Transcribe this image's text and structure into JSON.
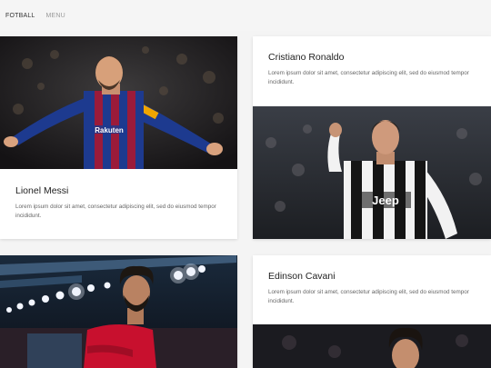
{
  "nav": {
    "brand": "FOTBALL",
    "menu": "MENU"
  },
  "cards": [
    {
      "title": "Lionel Messi",
      "text": "Lorem ipsum dolor sit amet, consectetur adipiscing elit, sed do eiusmod tempor incididunt.",
      "image": "lionel-messi-photo"
    },
    {
      "title": "Cristiano Ronaldo",
      "text": "Lorem ipsum dolor sit amet, consectetur adipiscing elit, sed do eiusmod tempor incididunt.",
      "image": "cristiano-ronaldo-photo"
    },
    {
      "title": "",
      "text": "",
      "image": "mohamed-salah-photo"
    },
    {
      "title": "Edinson Cavani",
      "text": "Lorem ipsum dolor sit amet, consectetur adipiscing elit, sed do eiusmod tempor incididunt.",
      "image": "edinson-cavani-photo"
    }
  ],
  "jersey": {
    "sponsor_left": "Rakuten",
    "sponsor_right": "Jeep"
  },
  "colors": {
    "barcelona_blue": "#1d3a8f",
    "barcelona_red": "#9b1b3a",
    "juventus_white": "#f2f2f2",
    "liverpool_red": "#c8102e",
    "psg_navy": "#1b2a4a"
  }
}
